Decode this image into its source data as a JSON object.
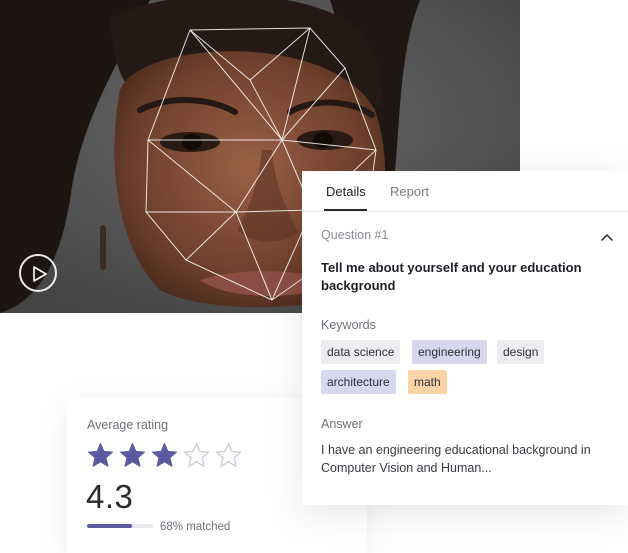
{
  "rating": {
    "label": "Average rating",
    "value": "4.3",
    "stars_filled": 3,
    "stars_total": 5,
    "match_fraction": 0.68,
    "match_text": "68% matched"
  },
  "details": {
    "tabs": [
      {
        "label": "Details",
        "active": true
      },
      {
        "label": "Report",
        "active": false
      }
    ],
    "question_label": "Question #1",
    "question_text": "Tell me about yourself and your education background",
    "keywords_label": "Keywords",
    "keywords": [
      {
        "text": "data science",
        "style": "gray"
      },
      {
        "text": "engineering",
        "style": "purple"
      },
      {
        "text": "design",
        "style": "gray"
      },
      {
        "text": "architecture",
        "style": "purple"
      },
      {
        "text": "math",
        "style": "orange"
      }
    ],
    "answer_label": "Answer",
    "answer_text": "I have an engineering educational background in Computer Vision and Human..."
  },
  "colors": {
    "accent": "#5b5a9f",
    "chip_gray": "#ededf0",
    "chip_purple": "#d7d7f0",
    "chip_orange": "#fcd3a6"
  },
  "icons": {
    "play": "play-icon",
    "collapse": "chevron-up-icon",
    "star": "star-icon"
  }
}
